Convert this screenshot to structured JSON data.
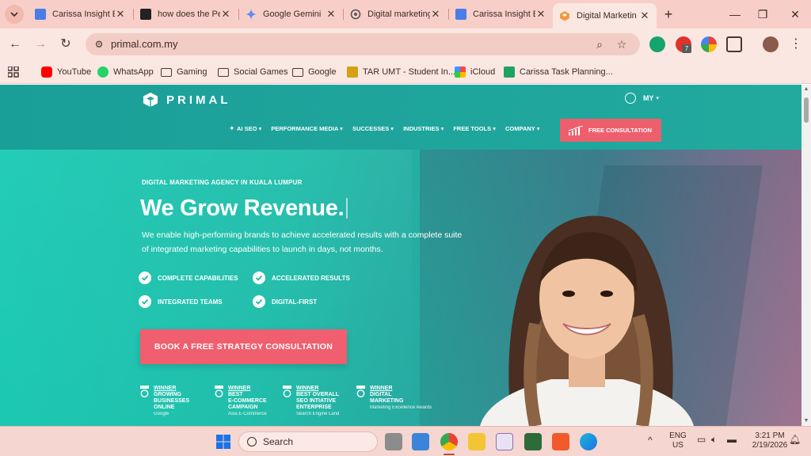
{
  "browser": {
    "tabs": [
      {
        "title": "Carissa Insight B",
        "fav_color": "#4a7de6",
        "active": false
      },
      {
        "title": "how does the Pe",
        "fav_color": "#222222",
        "active": false
      },
      {
        "title": "Google Gemini",
        "fav_color": "#5b8cf5",
        "active": false
      },
      {
        "title": "Digital marketing",
        "fav_color": "#666666",
        "active": false
      },
      {
        "title": "Carissa Insight B",
        "fav_color": "#4a7de6",
        "active": false
      },
      {
        "title": "Digital Marketin",
        "fav_color": "#f09a3e",
        "active": true
      }
    ],
    "url": "primal.com.my",
    "bookmarks": [
      {
        "label": "YouTube",
        "icon": "youtube-icon",
        "color": "#ff0000"
      },
      {
        "label": "WhatsApp",
        "icon": "whatsapp-icon",
        "color": "#25d366"
      },
      {
        "label": "Gaming",
        "icon": "folder-icon"
      },
      {
        "label": "Social Games",
        "icon": "folder-icon"
      },
      {
        "label": "Google",
        "icon": "folder-icon"
      },
      {
        "label": "TAR UMT - Student In...",
        "icon": "tarumt-icon",
        "color": "#d4a017"
      },
      {
        "label": "iCloud",
        "icon": "icloud-icon",
        "color": "#333333"
      },
      {
        "label": "Carissa Task Planning...",
        "icon": "sheets-icon",
        "color": "#1ea362"
      }
    ],
    "extension_badge": "7"
  },
  "site": {
    "brand": "PRIMAL",
    "locale": "MY",
    "nav": [
      {
        "label": "AI SEO",
        "sparkle": true
      },
      {
        "label": "PERFORMANCE MEDIA"
      },
      {
        "label": "SUCCESSES"
      },
      {
        "label": "INDUSTRIES"
      },
      {
        "label": "FREE TOOLS"
      },
      {
        "label": "COMPANY"
      }
    ],
    "header_cta": "FREE CONSULTATION",
    "hero": {
      "eyebrow": "DIGITAL MARKETING AGENCY IN KUALA LUMPUR",
      "headline": "We Grow Revenue.",
      "subcopy_line1": "We enable high-performing brands to achieve accelerated results with a complete suite",
      "subcopy_line2": "of integrated marketing capabilities to launch in days, not months.",
      "features": [
        "COMPLETE CAPABILITIES",
        "ACCELERATED RESULTS",
        "INTEGRATED TEAMS",
        "DIGITAL-FIRST"
      ],
      "cta": "BOOK A FREE STRATEGY CONSULTATION"
    },
    "awards": [
      {
        "winner": "WINNER",
        "lines": [
          "GROWING",
          "BUSINESSES",
          "ONLINE"
        ],
        "source": "Google"
      },
      {
        "winner": "WINNER",
        "lines": [
          "BEST",
          "E-COMMERCE",
          "CAMPAIGN"
        ],
        "source": "Asia E-Commerce"
      },
      {
        "winner": "WINNER",
        "lines": [
          "BEST OVERALL",
          "SEO INTIATIVE",
          "ENTERPRISE"
        ],
        "source": "Search Engine Land"
      },
      {
        "winner": "WINNER",
        "lines": [
          "DIGITAL",
          "MARKETING"
        ],
        "source": "Marketing Excellence Awards"
      }
    ],
    "colors": {
      "teal": "#1fb7a6",
      "coral_cta": "#ef5f6f",
      "pink_edge": "#c77197"
    }
  },
  "taskbar": {
    "search_label": "Search",
    "lang_line1": "ENG",
    "lang_line2": "US",
    "time": "3:21 PM",
    "date": "2/19/2026"
  }
}
